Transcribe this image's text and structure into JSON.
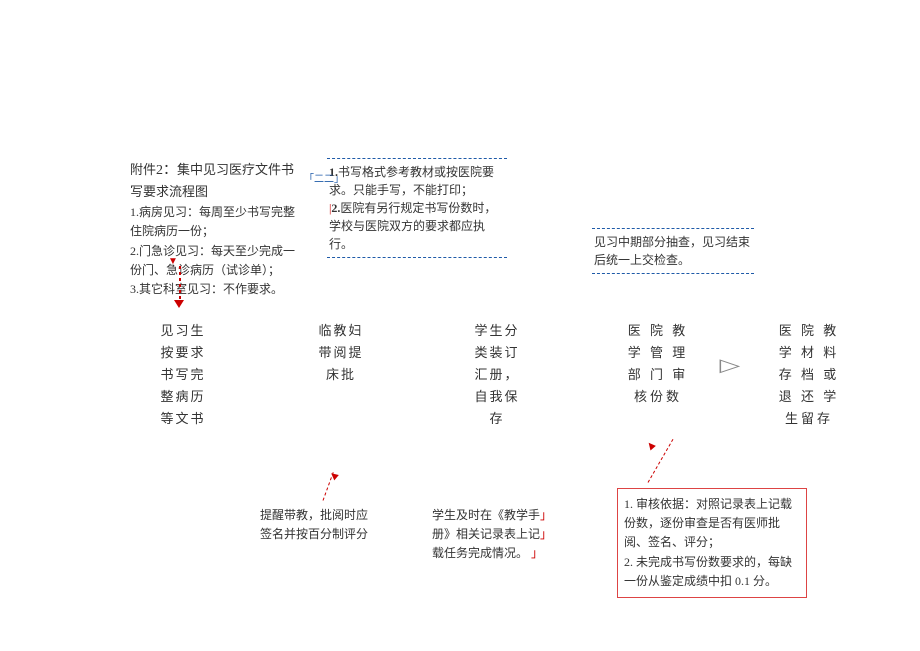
{
  "header": {
    "title_prefix": "附件",
    "title_num": "2：",
    "title_rest": "集中见习医疗文件书写要求流程图",
    "line1": "1.病房见习：每周至少书写完整住院病历一份；",
    "line2": "2.门急诊见习：每天至少完成一份门、急诊病历（试诊单）；",
    "line3_prefix": "3.其它科",
    "line3_mid": "室",
    "line3_rest": "见习：不作要求。"
  },
  "annotation_top_mid": {
    "line1": "1.书写格式参考教材或按医院要求。只能手写，不能打印；",
    "line2_prefix": "2.",
    "line2_rest": "医院有另行规定书写份数时，学校与医院双方的要求都应执行。"
  },
  "bracket_label": "「二二」",
  "annotation_top_right": {
    "line1": "见习中期部分抽查，见习结束",
    "line2": "后统一上交检查。"
  },
  "nodes": {
    "n1": {
      "l1": "见习生",
      "l2": "按要求",
      "l3": "书写完",
      "l4": "整病历",
      "l5": "等文书"
    },
    "n2": {
      "l1": "临教妇",
      "l2": "带阅提",
      "l3": "床批"
    },
    "n3": {
      "l1": "学生分",
      "l2": "类装订",
      "l3": "汇册，",
      "l4": "自我保",
      "l5": "存"
    },
    "n4": {
      "l1": "医 院 教",
      "l2": "学 管 理",
      "l3": "部 门 审",
      "l4": "核份数"
    },
    "n5": {
      "l1": "医 院 教",
      "l2": "学 材 料",
      "l3": "存 档 或",
      "l4": "退 还 学",
      "l5": "生留存"
    }
  },
  "bottom_notes": {
    "left": {
      "l1": "提醒带教，批阅时应",
      "l2": "签名并按百分制评分"
    },
    "mid": {
      "l1": "学生及时在《教学手",
      "l2": "册》相关记录表上记",
      "l3": "载任务完成情况。"
    }
  },
  "red_box": {
    "l1": "1. 审核依据：对照记录表上记载份数，逐份审查是否有医师批阅、签名、评分；",
    "l2": "2. 未完成书写份数要求的，每缺一份从鉴定成绩中扣 0.1 分。"
  }
}
